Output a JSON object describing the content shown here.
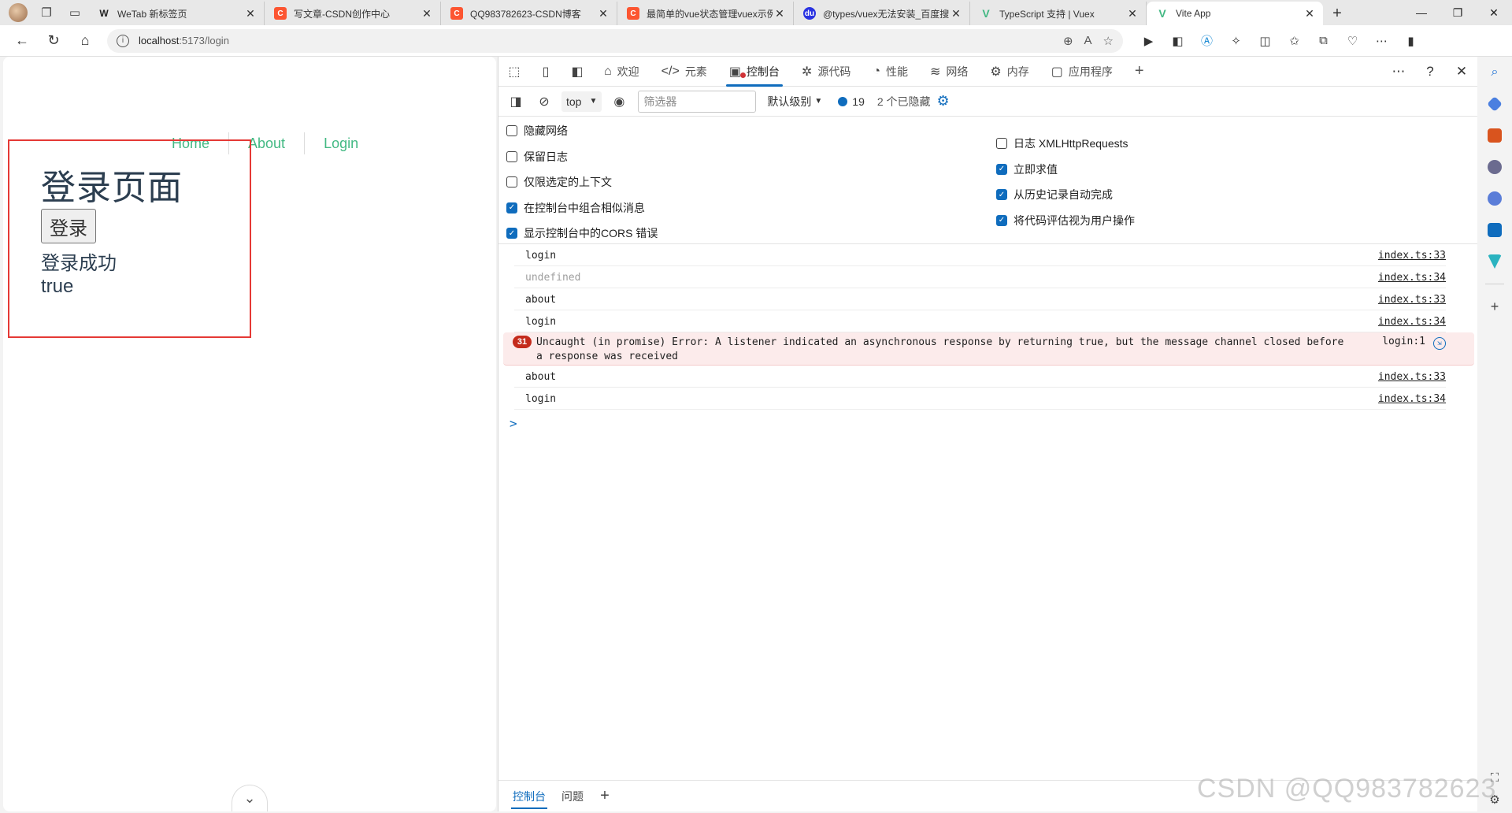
{
  "tabs": [
    {
      "title": "WeTab 新标签页",
      "favicon": "wetab-icon",
      "fav_text": "W"
    },
    {
      "title": "写文章-CSDN创作中心",
      "favicon": "csdn-icon",
      "fav_text": "C"
    },
    {
      "title": "QQ983782623-CSDN博客",
      "favicon": "csdn-icon",
      "fav_text": "C"
    },
    {
      "title": "最简单的vue状态管理vuex示例",
      "favicon": "csdn-icon",
      "fav_text": "C"
    },
    {
      "title": "@types/vuex无法安装_百度搜索",
      "favicon": "baidu-icon",
      "fav_text": "du"
    },
    {
      "title": "TypeScript 支持 | Vuex",
      "favicon": "vue-icon",
      "fav_text": "V"
    },
    {
      "title": "Vite App",
      "favicon": "vue-icon",
      "fav_text": "V"
    }
  ],
  "address": {
    "host": "localhost",
    "path": ":5173/login"
  },
  "page": {
    "nav": [
      "Home",
      "About",
      "Login"
    ],
    "heading": "登录页面",
    "button": "登录",
    "status": "登录成功",
    "value": "true",
    "chevron": "⌄"
  },
  "devtools": {
    "tabs": [
      {
        "label": "欢迎",
        "icon": "⌂"
      },
      {
        "label": "元素",
        "icon": "</>"
      },
      {
        "label": "控制台",
        "icon": "▣"
      },
      {
        "label": "源代码",
        "icon": "✲"
      },
      {
        "label": "性能",
        "icon": "◔"
      },
      {
        "label": "网络",
        "icon": "≋"
      },
      {
        "label": "内存",
        "icon": "⚙"
      },
      {
        "label": "应用程序",
        "icon": "▢"
      }
    ],
    "context": "top",
    "filter_placeholder": "筛选器",
    "levels": "默认级别",
    "message_count": "19",
    "hidden": "2 个已隐藏",
    "settings_left": [
      {
        "label": "隐藏网络",
        "checked": false
      },
      {
        "label": "保留日志",
        "checked": false
      },
      {
        "label": "仅限选定的上下文",
        "checked": false
      },
      {
        "label": "在控制台中组合相似消息",
        "checked": true
      },
      {
        "label": "显示控制台中的CORS 错误",
        "checked": true
      }
    ],
    "settings_right": [
      {
        "label": "日志 XMLHttpRequests",
        "checked": false
      },
      {
        "label": "立即求值",
        "checked": true
      },
      {
        "label": "从历史记录自动完成",
        "checked": true
      },
      {
        "label": "将代码评估视为用户操作",
        "checked": true
      }
    ],
    "logs": [
      {
        "msg": "login",
        "src": "index.ts:33"
      },
      {
        "msg": "undefined",
        "src": "index.ts:34",
        "muted": true
      },
      {
        "msg": "about",
        "src": "index.ts:33"
      },
      {
        "msg": "login",
        "src": "index.ts:34"
      },
      {
        "error": true,
        "count": "31",
        "msg": "Uncaught (in promise) Error: A listener indicated an asynchronous response by returning true, but the message channel closed before a response was received",
        "src": "login:1"
      },
      {
        "msg": "about",
        "src": "index.ts:33"
      },
      {
        "msg": "login",
        "src": "index.ts:34"
      }
    ],
    "prompt": ">",
    "drawer": {
      "console": "控制台",
      "issues": "问题"
    }
  },
  "watermark": "CSDN @QQ983782623",
  "colors": {
    "accent": "#0f6cbd",
    "vue_green": "#42b983",
    "error_bg": "#fcebeb",
    "highlight": "#e53935"
  }
}
